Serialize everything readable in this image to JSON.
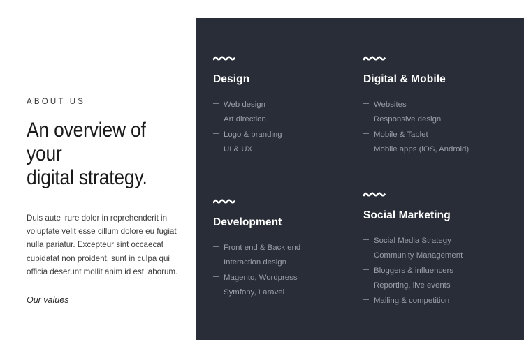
{
  "left": {
    "eyebrow": "ABOUT US",
    "headline": "An overview of your\ndigital strategy.",
    "paragraph": "Duis aute irure dolor in reprehenderit in voluptate velit esse cillum dolore eu fugiat nulla pariatur. Excepteur sint occaecat cupidatat non proident, sunt in culpa qui officia deserunt mollit anim id est laborum.",
    "link_label": "Our values"
  },
  "panel": {
    "background_color": "#292d37",
    "heading_color": "#ffffff",
    "list_color": "#9a9ea8",
    "blocks": [
      {
        "icon": "squiggle-icon",
        "title": "Design",
        "items": [
          "Web design",
          "Art direction",
          "Logo & branding",
          "UI & UX"
        ]
      },
      {
        "icon": "squiggle-icon",
        "title": "Digital & Mobile",
        "items": [
          "Websites",
          "Responsive design",
          "Mobile & Tablet",
          "Mobile apps (iOS, Android)"
        ]
      },
      {
        "icon": "squiggle-icon",
        "title": "Development",
        "items": [
          "Front end & Back end",
          "Interaction design",
          "Magento, Wordpress",
          "Symfony, Laravel"
        ]
      },
      {
        "icon": "squiggle-icon",
        "title": "Social Marketing",
        "items": [
          "Social Media Strategy",
          "Community Management",
          "Bloggers & influencers",
          "Reporting, live events",
          "Mailing & competition"
        ]
      }
    ]
  }
}
